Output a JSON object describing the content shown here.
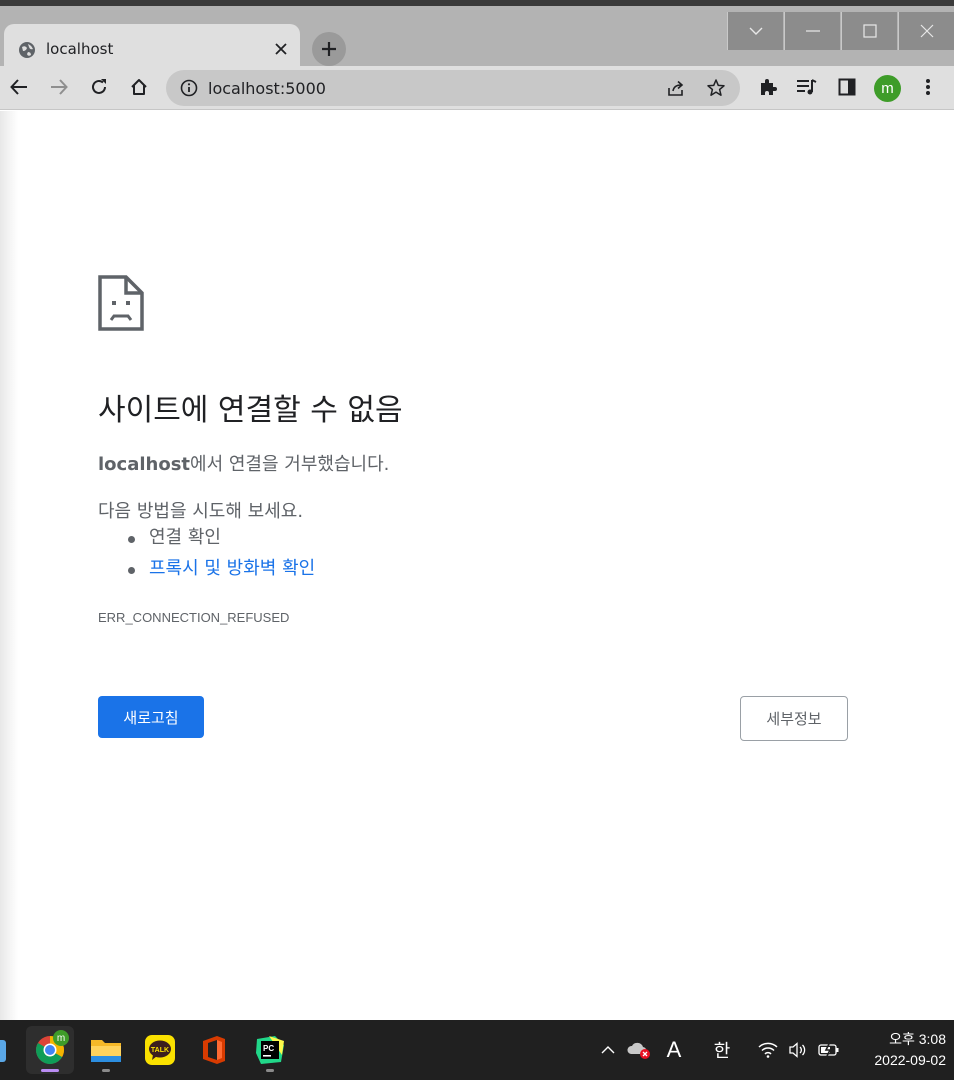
{
  "browser": {
    "tab_title": "localhost",
    "url": "localhost:5000",
    "profile_initial": "m"
  },
  "error_page": {
    "heading": "사이트에 연결할 수 없음",
    "host": "localhost",
    "host_suffix": "에서 연결을 거부했습니다.",
    "suggestions_intro": "다음 방법을 시도해 보세요.",
    "suggestions": [
      {
        "label": "연결 확인",
        "link": false
      },
      {
        "label": "프록시 및 방화벽 확인",
        "link": true
      }
    ],
    "error_code": "ERR_CONNECTION_REFUSED",
    "reload_label": "새로고침",
    "details_label": "세부정보"
  },
  "taskbar": {
    "apps": [
      "chrome-icon",
      "file-explorer-icon",
      "kakaotalk-icon",
      "office-icon",
      "pycharm-icon"
    ],
    "ime_mode": "A",
    "ime_language": "한",
    "time": "오후 3:08",
    "date": "2022-09-02"
  },
  "colors": {
    "accent": "#1a73e8",
    "text_muted": "#5f6368",
    "chrome_frame": "#b3b3b3",
    "taskbar": "#202020"
  }
}
